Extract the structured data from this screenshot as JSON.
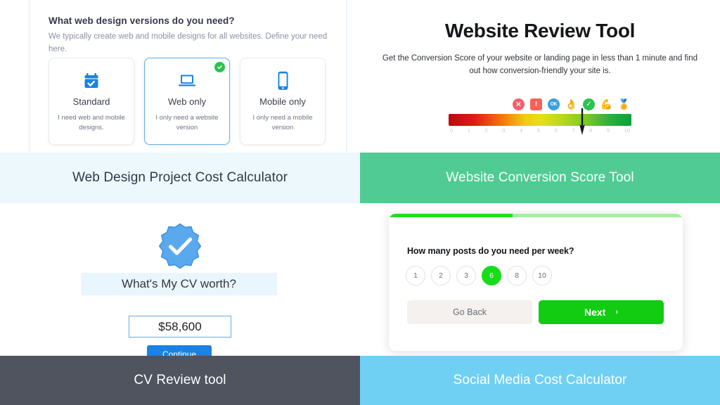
{
  "web_design_tool": {
    "question": "What web design versions do you need?",
    "subtitle": "We typically create web and mobile designs for all websites. Define your need here.",
    "options": [
      {
        "icon": "calendar-check-icon",
        "name": "Standard",
        "desc": "I need web and mobile designs.",
        "selected": false
      },
      {
        "icon": "laptop-icon",
        "name": "Web only",
        "desc": "I only need a website version",
        "selected": true
      },
      {
        "icon": "mobile-phone-icon",
        "name": "Mobile only",
        "desc": "I only need a mobile version",
        "selected": false
      }
    ]
  },
  "website_review_tool": {
    "title": "Website Review Tool",
    "subtitle": "Get the Conversion Score of your website or landing page in less than 1 minute and find out how conversion-friendly your site is.",
    "scale_icons": [
      "x-circle-icon",
      "exclamation-box-icon",
      "ok-badge-icon",
      "ok-hand-icon",
      "check-circle-icon",
      "flexed-biceps-icon",
      "award-medal-icon"
    ],
    "scale_numbers": [
      "0",
      "1",
      "2",
      "3",
      "4",
      "5",
      "6",
      "7",
      "8",
      "9",
      "10"
    ],
    "needle_value": 7.3,
    "colors": {
      "low": "#b50d0d",
      "mid": "#e8e016",
      "high": "#0aa13a"
    }
  },
  "cv_tool": {
    "badge_icon": "verified-check-badge-icon",
    "headline": "What's My CV worth?",
    "amount": "$58,600",
    "continue_label": "Continue"
  },
  "social_media_tool": {
    "progress_percent": 42,
    "question": "How many posts do you need per week?",
    "options": [
      "1",
      "2",
      "3",
      "6",
      "8",
      "10"
    ],
    "selected_option": "6",
    "back_label": "Go Back",
    "next_label": "Next",
    "next_chevron": "chevron-right-icon"
  },
  "banners": {
    "top_left": {
      "label": "Web Design Project Cost Calculator",
      "bg": "#edf8fd",
      "fg": "#2d3b45"
    },
    "top_right": {
      "label": "Website Conversion Score Tool",
      "bg": "#50cb93",
      "fg": "#ffffff"
    },
    "bottom_left": {
      "label": "CV Review tool",
      "bg": "#4f545e",
      "fg": "#ffffff"
    },
    "bottom_right": {
      "label": "Social Media Cost Calculator",
      "bg": "#6fd0f3",
      "fg": "#ffffff"
    }
  }
}
